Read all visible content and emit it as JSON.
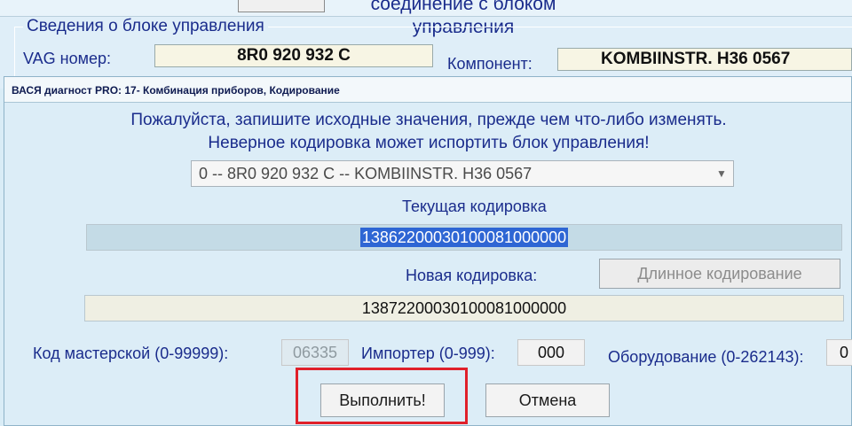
{
  "background": {
    "title": "соединение с блоком\nуправления",
    "group_title": "Сведения о блоке управления",
    "vag_label": "VAG номер:",
    "vag_value": "8R0 920 932 C",
    "component_label": "Компонент:",
    "component_value": "KOMBIINSTR.   H36 0567"
  },
  "dialog": {
    "title": "ВАСЯ диагност PRO: 17- Комбинация приборов,  Кодирование",
    "warning_line1": "Пожалуйста, запишите исходные значения, прежде чем что-либо изменять.",
    "warning_line2": "Неверное кодировка может испортить блок управления!",
    "select_value": "0 -- 8R0 920 932 C -- KOMBIINSTR.   H36 0567",
    "current_label": "Текущая кодировка",
    "current_value": "13862200030100081000000",
    "new_label": "Новая кодировка:",
    "new_value": "13872200030100081000000",
    "long_coding_button": "Длинное кодирование",
    "workshop_label": "Код мастерской (0-99999):",
    "workshop_value": "06335",
    "importer_label": "Импортер (0-999):",
    "importer_value": "000",
    "equipment_label": "Оборудование (0-262143):",
    "equipment_value": "0",
    "execute_button": "Выполнить!",
    "cancel_button": "Отмена"
  },
  "colors": {
    "highlight": "#e0202a",
    "selection": "#2e66d4",
    "label_text": "#1a2c8c"
  }
}
